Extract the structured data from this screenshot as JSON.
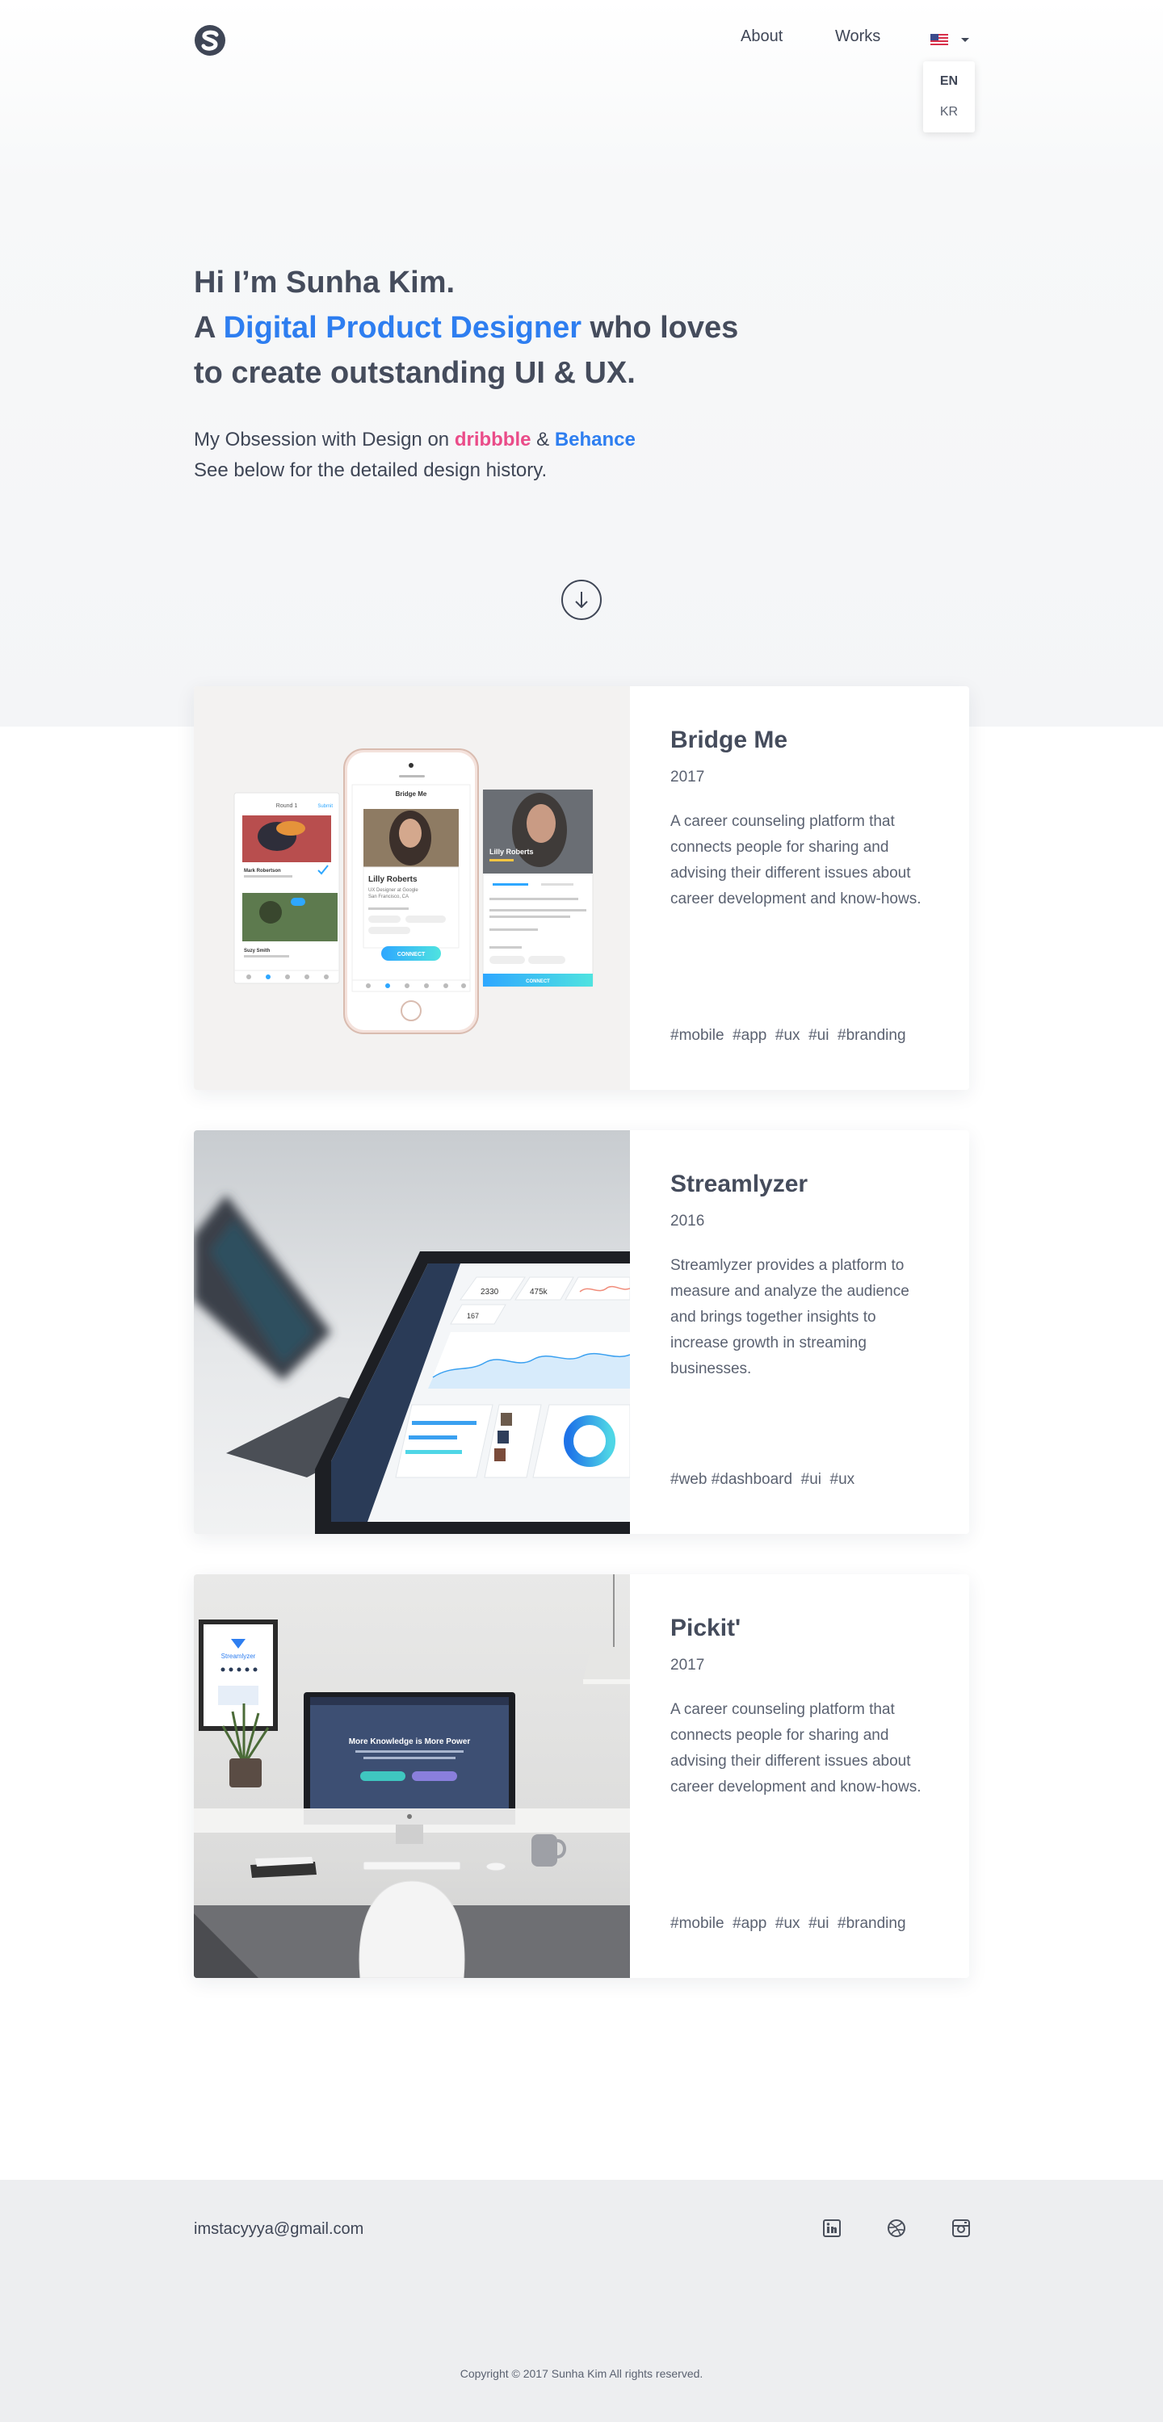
{
  "header": {
    "nav": {
      "about": "About",
      "works": "Works"
    },
    "language": {
      "options": [
        "EN",
        "KR"
      ],
      "selected": "EN"
    }
  },
  "hero": {
    "line1": "Hi I’m Sunha Kim.",
    "line2_prefix": "A ",
    "line2_accent": "Digital Product Designer",
    "line2_suffix": " who loves",
    "line3": "to create outstanding UI & UX.",
    "sub_prefix": "My Obsession with Design on ",
    "sub_dribbble": "dribbble",
    "sub_and": " & ",
    "sub_behance": "Behance",
    "sub_line2": "See below for the detailed design history."
  },
  "projects": [
    {
      "title": "Bridge Me",
      "year": "2017",
      "description": "A career counseling platform that connects people for sharing and advising their different issues about career development and know-hows.",
      "tags": "#mobile  #app  #ux  #ui  #branding",
      "mockup": {
        "left_header": "Round 1",
        "left_action": "Submit",
        "left_name1": "Mark Robertson",
        "left_name2": "Suzy Smith",
        "center_header": "Bridge Me",
        "center_name": "Lilly Roberts",
        "center_role": "UX Designer at Google",
        "center_location": "San Francisco, CA",
        "center_btn": "CONNECT",
        "right_name": "Lilly Roberts",
        "right_btn": "CONNECT"
      }
    },
    {
      "title": "Streamlyzer",
      "year": "2016",
      "description": "Streamlyzer provides a platform to measure and analyze the audience and brings together insights to increase growth in streaming businesses.",
      "tags": "#web #dashboard  #ui  #ux",
      "mockup": {
        "stat1": "2330",
        "stat2": "475k",
        "stat3": "167"
      }
    },
    {
      "title": "Pickit'",
      "year": "2017",
      "description": "A career counseling platform that connects people for sharing and advising their different issues about career development and know-hows.",
      "tags": "#mobile  #app  #ux  #ui  #branding",
      "mockup": {
        "screen_heading": "More Knowledge is More Power",
        "poster_brand": "Streamlyzer"
      }
    }
  ],
  "footer": {
    "email": "imstacyyya@gmail.com",
    "copyright": "Copyright © 2017 Sunha Kim All rights reserved.",
    "social": [
      "linkedin-icon",
      "dribbble-icon",
      "instagram-icon"
    ]
  },
  "colors": {
    "accent_blue": "#2e7ef0",
    "dribbble_pink": "#ea4c89",
    "text_dark": "#3f4656",
    "footer_bg": "#edeef0"
  }
}
